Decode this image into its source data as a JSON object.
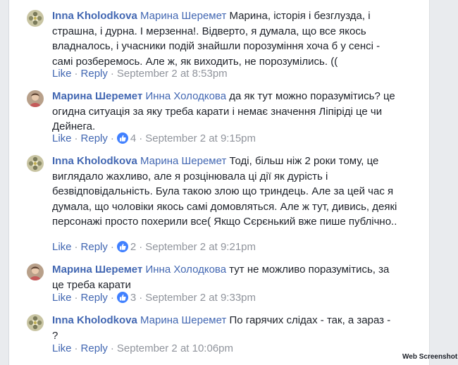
{
  "comments": [
    {
      "author": "Inna Kholodkova",
      "mention": "Марина Шеремет",
      "text": "Марина, історія і безглузда, і страшна, і дурна. І мерзенна!. Відверто, я думала, що все якось владналось, і учасники подій знайшли порозуміння хоча б у сенсі - самі розберемось. Але ж, як виходить, не порозумілись. ((",
      "like_label": "Like",
      "reply_label": "Reply",
      "reactions": "",
      "timestamp": "September 2 at 8:53pm",
      "avatar_icon": "flower-avatar-icon"
    },
    {
      "author": "Марина Шеремет",
      "mention": "Инна Холодкова",
      "text": "да як тут можно поразумітись? це огидна ситуація за яку треба карати і немає значення Ліпіріді це чи Дейнега.",
      "like_label": "Like",
      "reply_label": "Reply",
      "reactions": "4",
      "timestamp": "September 2 at 9:15pm",
      "avatar_icon": "person-avatar-icon"
    },
    {
      "author": "Inna Kholodkova",
      "mention": "Марина Шеремет",
      "text": "Тоді, більш ніж 2 роки тому, це виглядало жахливо, але я розцінювала ці дії як дурість і безвідповідальність. Була такою злою що триндець. Але за цей час я думала, що чоловіки якось самі домовляться. Але ж тут, дивись, деякі персонажі просто похерили все( Якщо Сєрєнький вже пише публічно..",
      "like_label": "Like",
      "reply_label": "Reply",
      "reactions": "2",
      "timestamp": "September 2 at 9:21pm",
      "avatar_icon": "flower-avatar-icon"
    },
    {
      "author": "Марина Шеремет",
      "mention": "Инна Холодкова",
      "text": "тут не можливо поразумітись, за це треба карати",
      "like_label": "Like",
      "reply_label": "Reply",
      "reactions": "3",
      "timestamp": "September 2 at 9:33pm",
      "avatar_icon": "person-avatar-icon"
    },
    {
      "author": "Inna Kholodkova",
      "mention": "Марина Шеремет",
      "text": "По гарячих слідах - так, а зараз - ?",
      "like_label": "Like",
      "reply_label": "Reply",
      "reactions": "",
      "timestamp": "September 2 at 10:06pm",
      "avatar_icon": "flower-avatar-icon"
    }
  ],
  "watermark": "Web Screenshot",
  "colors": {
    "link": "#4267b2",
    "meta": "#90949c",
    "like_badge": "#4080ff"
  }
}
